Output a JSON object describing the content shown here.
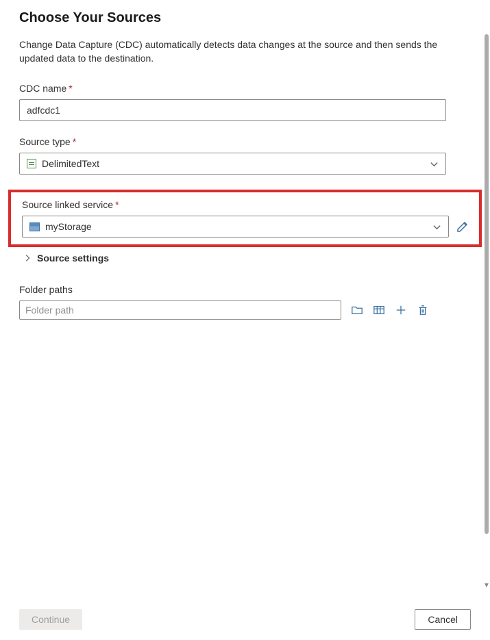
{
  "header": {
    "title": "Choose Your Sources",
    "description": "Change Data Capture (CDC) automatically detects data changes at the source and then sends the updated data to the destination."
  },
  "fields": {
    "cdc_name": {
      "label": "CDC name",
      "value": "adfcdc1"
    },
    "source_type": {
      "label": "Source type",
      "value": "DelimitedText"
    },
    "linked_service": {
      "label": "Source linked service",
      "value": "myStorage"
    },
    "source_settings": {
      "label": "Source settings"
    },
    "folder_paths": {
      "label": "Folder paths",
      "placeholder": "Folder path"
    }
  },
  "footer": {
    "continue": "Continue",
    "cancel": "Cancel"
  }
}
